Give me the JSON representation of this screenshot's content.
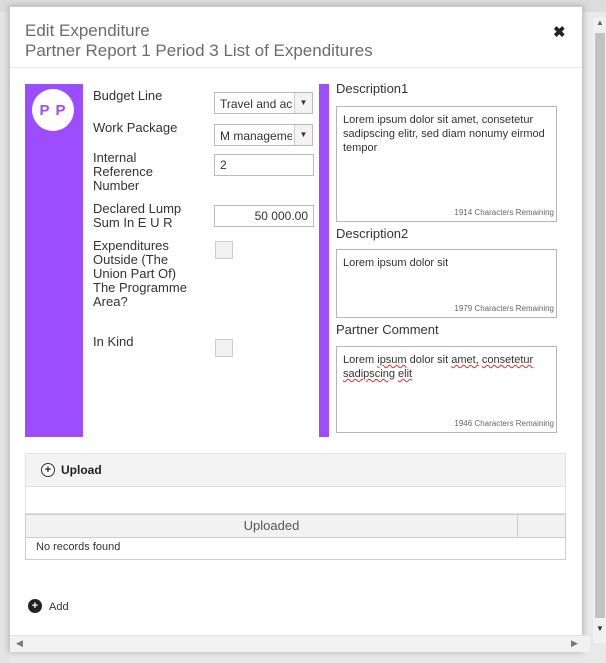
{
  "dialog": {
    "title": "Edit Expenditure",
    "subtitle": "Partner Report 1 Period 3 List of Expenditures",
    "close_icon": "close-icon"
  },
  "avatar": {
    "initials": "P P"
  },
  "form": {
    "budget_line": {
      "label": "Budget Line",
      "value": "Travel and ac"
    },
    "work_package": {
      "label": "Work Package",
      "value": "M manageme"
    },
    "internal_reference": {
      "label": "Internal Reference Number",
      "value": "2"
    },
    "declared_lump_sum": {
      "label": "Declared Lump Sum In E U R",
      "value": "50 000.00"
    },
    "outside_area": {
      "label": "Expenditures Outside (The Union Part Of) The Programme Area?"
    },
    "in_kind": {
      "label": "In Kind"
    }
  },
  "description1": {
    "label": "Description1",
    "text": "Lorem ipsum dolor sit amet, consetetur sadipscing elitr, sed diam nonumy eirmod tempor",
    "remaining": "1914 Characters Remaining"
  },
  "description2": {
    "label": "Description2",
    "text": "Lorem ipsum dolor sit",
    "remaining": "1979 Characters Remaining"
  },
  "partner_comment": {
    "label": "Partner Comment",
    "text_part1": "Lorem",
    "text_part2": "ipsum",
    "text_part3": "dolor sit",
    "text_part4": "amet,",
    "text_part5": "consetetur",
    "text_part6": "sadipscing",
    "text_part7": "elit",
    "remaining": "1946 Characters Remaining"
  },
  "upload": {
    "label": "Upload",
    "column_header": "Uploaded",
    "empty_text": "No records found"
  },
  "add": {
    "label": "Add"
  },
  "colors": {
    "accent": "#9c4dff"
  }
}
